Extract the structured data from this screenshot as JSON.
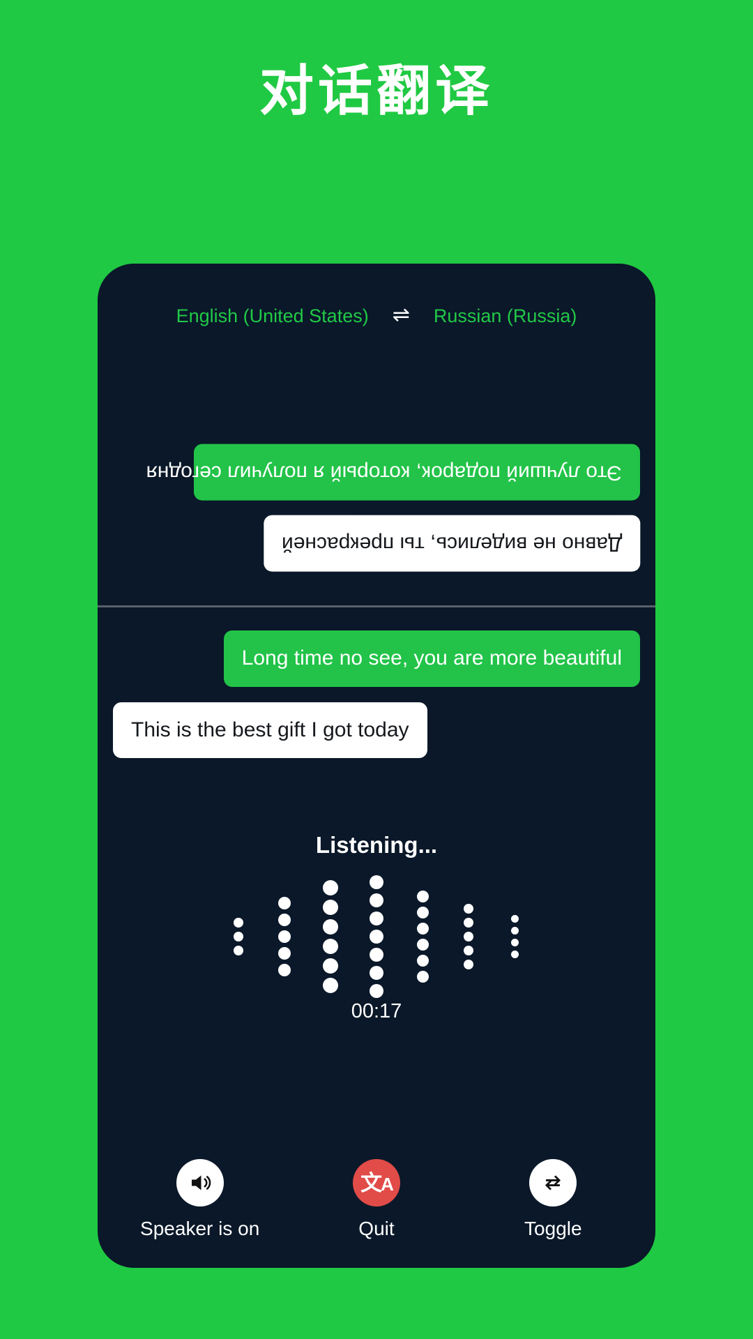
{
  "page": {
    "title": "对话翻译",
    "background_color": "#20c943"
  },
  "phone": {
    "background_color": "#0a1829",
    "accent_green": "#22c348",
    "danger_red": "#e14b48"
  },
  "language_bar": {
    "source_language": "English (United States)",
    "swap_icon": "swap-horizontal-icon",
    "swap_glyph": "⇌",
    "target_language": "Russian (Russia)"
  },
  "conversation": {
    "translated_pane": {
      "orientation": "rotated-180",
      "messages": [
        {
          "text": "Это лучший подарок, который я получил сегодня",
          "style": "green",
          "align": "right"
        },
        {
          "text": "Давно не виделись, ты прекрасней",
          "style": "white",
          "align": "right"
        }
      ]
    },
    "source_pane": {
      "orientation": "normal",
      "messages": [
        {
          "text": "Long time no see, you are more beautiful",
          "style": "green",
          "align": "right"
        },
        {
          "text": "This is the best gift I got today",
          "style": "white",
          "align": "left"
        }
      ]
    }
  },
  "recording": {
    "status_text": "Listening...",
    "timer": "00:17",
    "waveform": {
      "columns": [
        {
          "dots": 3,
          "size": 14
        },
        {
          "dots": 5,
          "size": 18
        },
        {
          "dots": 6,
          "size": 22
        },
        {
          "dots": 7,
          "size": 20
        },
        {
          "dots": 6,
          "size": 17
        },
        {
          "dots": 5,
          "size": 14
        },
        {
          "dots": 4,
          "size": 11
        }
      ]
    }
  },
  "controls": [
    {
      "label": "Speaker is on",
      "icon": "speaker-on-icon",
      "style": "light"
    },
    {
      "label": "Quit",
      "icon": "translate-icon",
      "style": "danger"
    },
    {
      "label": "Toggle",
      "icon": "toggle-swap-icon",
      "style": "light"
    }
  ]
}
